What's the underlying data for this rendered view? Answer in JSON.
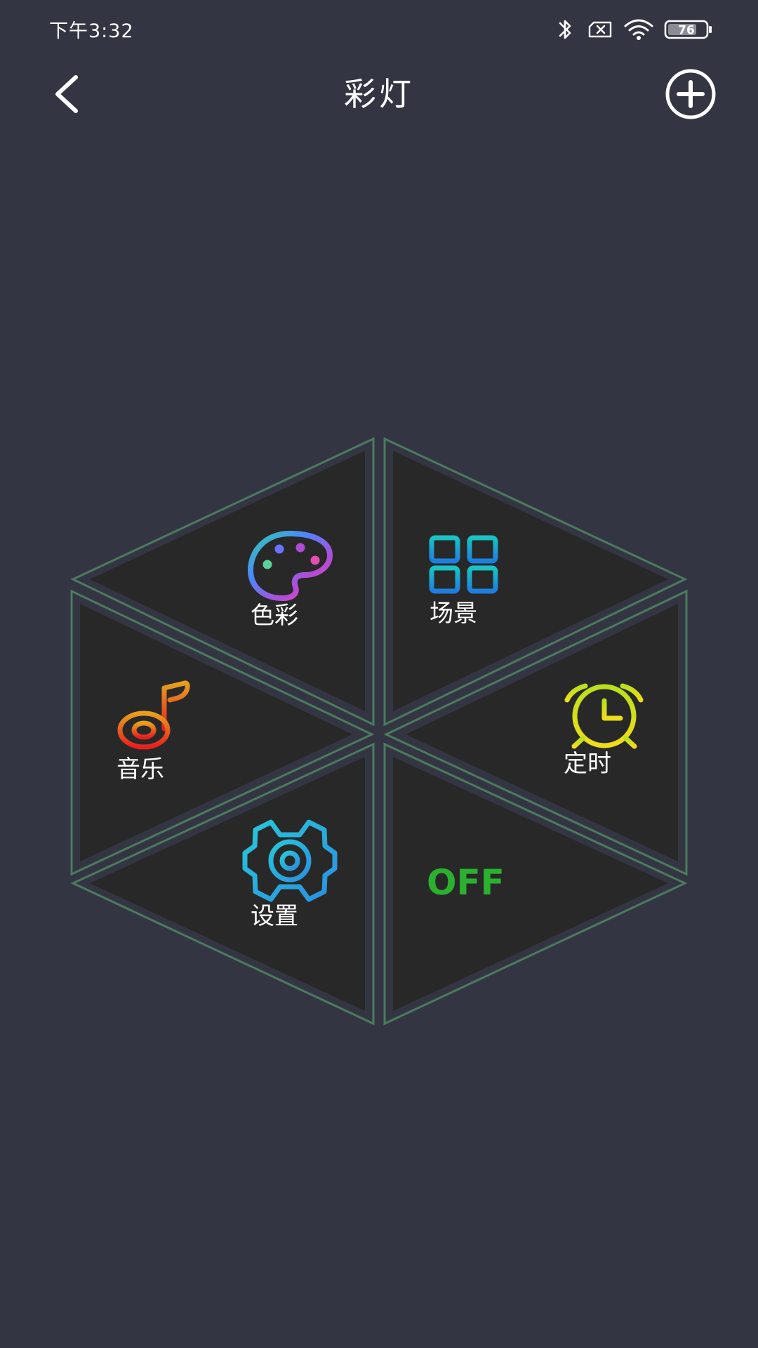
{
  "status_bar": {
    "time": "下午3:32",
    "battery_level": "76"
  },
  "header": {
    "title": "彩灯"
  },
  "menu": {
    "color_label": "色彩",
    "scene_label": "场景",
    "music_label": "音乐",
    "timer_label": "定时",
    "settings_label": "设置",
    "off_label": "OFF"
  },
  "colors": {
    "background": "#333642",
    "segment_fill": "#282828",
    "segment_outline": "#4c7a5e",
    "off_text": "#2bb12f"
  },
  "icons": {
    "back": "chevron-left-icon",
    "add": "plus-circle-icon",
    "color": "palette-icon",
    "scene": "grid-icon",
    "music": "music-note-icon",
    "timer": "alarm-clock-icon",
    "settings": "gear-icon"
  }
}
